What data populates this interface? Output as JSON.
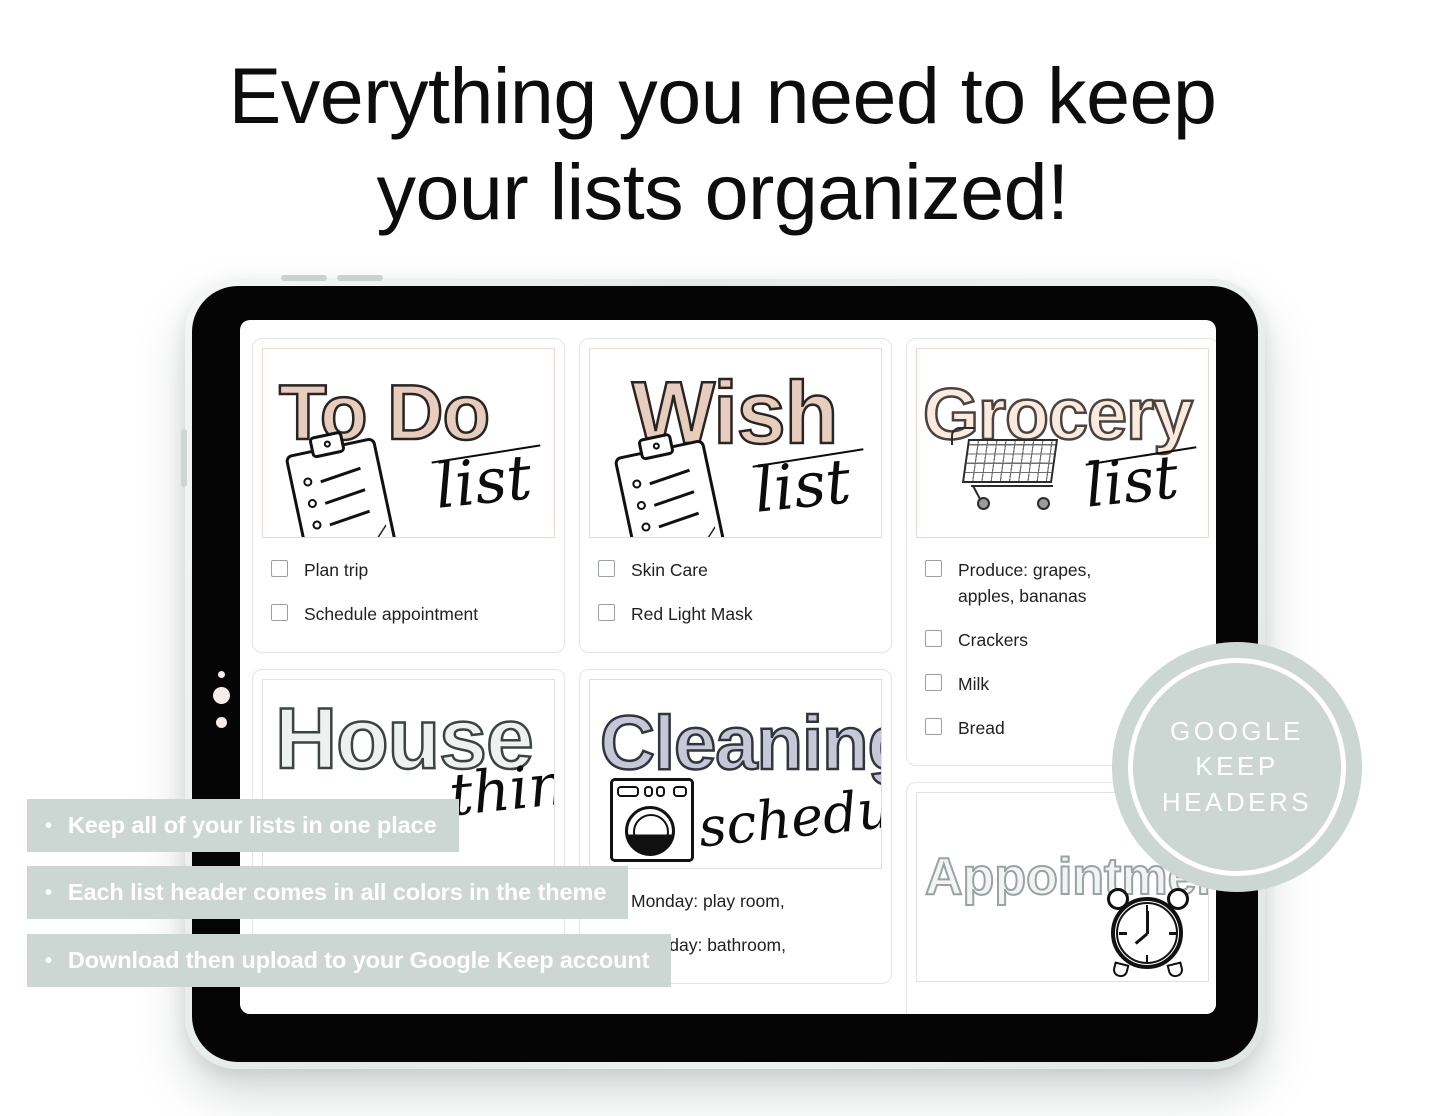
{
  "headline": {
    "line1": "Everything you need to keep",
    "line2": "your lists organized!"
  },
  "colors": {
    "callout_bg": "#ccd6d3",
    "callout_text": "#ffffff",
    "badge_bg": "#ccd6d3",
    "blush": "#e7cdbe",
    "cream": "#fbeade",
    "sage": "#eef1ef",
    "lavender": "#c6c8d8",
    "grey": "#f2f4f4",
    "bezel": "#050505"
  },
  "callouts": [
    {
      "bullet": "•",
      "text": "Keep all of your lists in one place"
    },
    {
      "bullet": "•",
      "text": "Each list header comes in all colors in the theme"
    },
    {
      "bullet": "•",
      "text": "Download then upload to your Google Keep account"
    }
  ],
  "badge": {
    "line1": "GOOGLE",
    "line2": "KEEP",
    "line3": "HEADERS"
  },
  "notes": {
    "todo": {
      "title_main": "To Do",
      "title_script": "list",
      "icon": "clipboard-icon",
      "items": [
        {
          "label": "Plan trip",
          "checked": false
        },
        {
          "label": "Schedule appointment",
          "checked": false
        }
      ]
    },
    "wish": {
      "title_main": "Wish",
      "title_script": "list",
      "icon": "clipboard-icon",
      "items": [
        {
          "label": "Skin Care",
          "checked": false
        },
        {
          "label": "Red Light Mask",
          "checked": false
        }
      ]
    },
    "grocery": {
      "title_main": "Grocery",
      "title_script": "list",
      "icon": "shopping-cart-icon",
      "items": [
        {
          "label": "Produce: grapes, apples, bananas",
          "checked": false
        },
        {
          "label": "Crackers",
          "checked": false
        },
        {
          "label": "Milk",
          "checked": false
        },
        {
          "label": "Bread",
          "checked": false
        }
      ]
    },
    "house": {
      "title_main": "House",
      "title_script": "things",
      "icon": "house-icon",
      "items": []
    },
    "cleaning": {
      "title_main": "Cleaning",
      "title_script": "schedule",
      "icon": "washing-machine-icon",
      "items": [
        {
          "label": "Monday: play room,",
          "checked": false
        },
        {
          "label": "Tuesday: bathroom,",
          "checked": false
        }
      ]
    },
    "appointments": {
      "title_main": "Appointments",
      "title_script": "",
      "icon": "alarm-clock-icon",
      "items": []
    }
  }
}
